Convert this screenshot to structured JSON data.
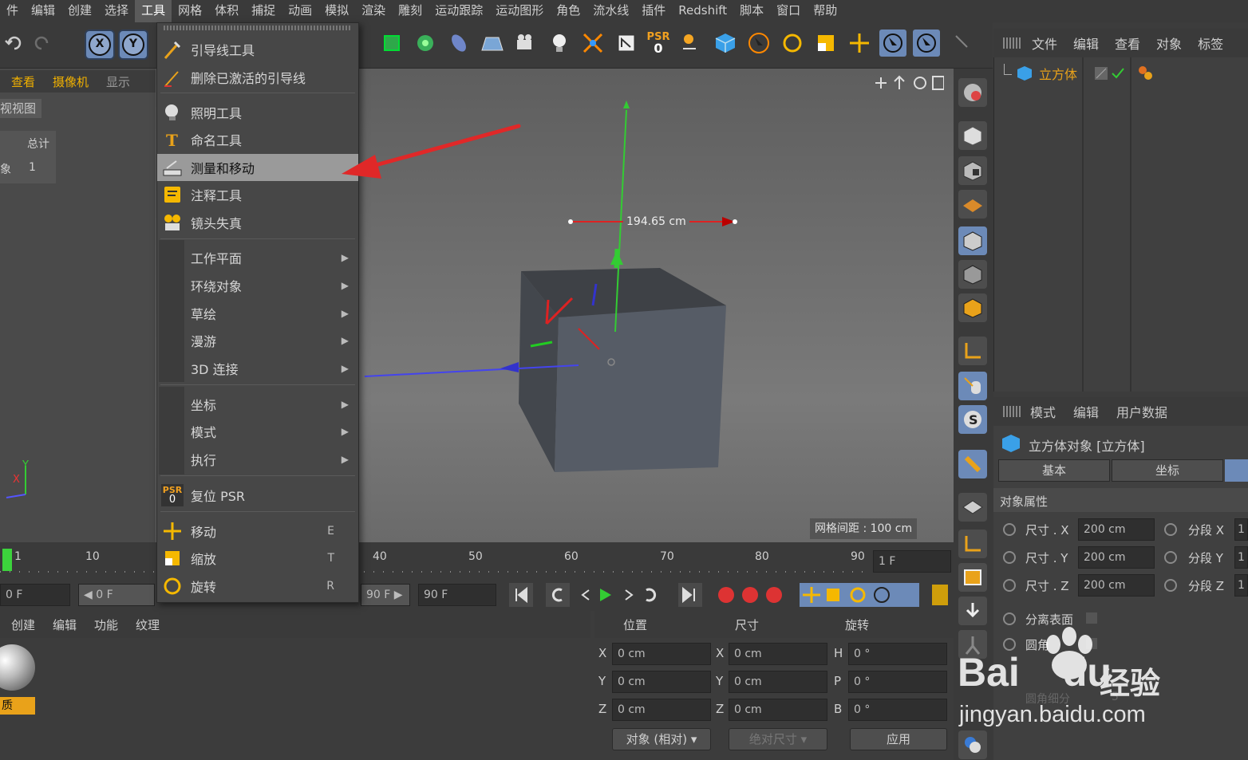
{
  "menubar": [
    "件",
    "编辑",
    "创建",
    "选择",
    "工具",
    "网格",
    "体积",
    "捕捉",
    "动画",
    "模拟",
    "渲染",
    "雕刻",
    "运动跟踪",
    "运动图形",
    "角色",
    "流水线",
    "插件",
    "Redshift",
    "脚本",
    "窗口",
    "帮助"
  ],
  "toolbar": {
    "psr_label": "PSR",
    "psr_value": "0"
  },
  "viewport": {
    "tabs": [
      "查看",
      "摄像机",
      "显示"
    ],
    "view_name": "视视图",
    "stats_header": "总计",
    "stats_label": "象",
    "stats_value": "1",
    "measure_label": "194.65 cm",
    "grid_spacing": "网格间距 : 100 cm",
    "axis_y": "Y",
    "axis_x": "X"
  },
  "tools_menu": {
    "items": [
      {
        "label": "引导线工具",
        "shortcut": "",
        "submenu": false
      },
      {
        "label": "删除已激活的引导线",
        "shortcut": "",
        "submenu": false
      },
      {
        "label": "照明工具",
        "shortcut": "",
        "submenu": false
      },
      {
        "label": "命名工具",
        "shortcut": "",
        "submenu": false
      },
      {
        "label": "测量和移动",
        "shortcut": "",
        "submenu": false
      },
      {
        "label": "注释工具",
        "shortcut": "",
        "submenu": false
      },
      {
        "label": "镜头失真",
        "shortcut": "",
        "submenu": false
      },
      {
        "label": "工作平面",
        "shortcut": "",
        "submenu": true
      },
      {
        "label": "环绕对象",
        "shortcut": "",
        "submenu": true
      },
      {
        "label": "草绘",
        "shortcut": "",
        "submenu": true
      },
      {
        "label": "漫游",
        "shortcut": "",
        "submenu": true
      },
      {
        "label": "3D 连接",
        "shortcut": "",
        "submenu": true
      },
      {
        "label": "坐标",
        "shortcut": "",
        "submenu": true
      },
      {
        "label": "模式",
        "shortcut": "",
        "submenu": true
      },
      {
        "label": "执行",
        "shortcut": "",
        "submenu": true
      },
      {
        "label": "复位 PSR",
        "shortcut": "",
        "submenu": false
      },
      {
        "label": "移动",
        "shortcut": "E",
        "submenu": false
      },
      {
        "label": "缩放",
        "shortcut": "T",
        "submenu": false
      },
      {
        "label": "旋转",
        "shortcut": "R",
        "submenu": false
      }
    ],
    "psr_icon_text": "PSR",
    "psr_icon_num": "0"
  },
  "timeline": {
    "ticks": [
      "1",
      "10",
      "40",
      "50",
      "60",
      "70",
      "80",
      "90"
    ],
    "current_frame": "1 F"
  },
  "playback": {
    "start_field": "0 F",
    "start_field2": "◀ 0 F",
    "end_field2": "90 F ▶",
    "end_field": "90 F"
  },
  "material_panel": {
    "tabs": [
      "创建",
      "编辑",
      "功能",
      "纹理"
    ],
    "material_label": "质"
  },
  "coords_panel": {
    "headers": [
      "位置",
      "尺寸",
      "旋转"
    ],
    "rows": [
      {
        "axis": "X",
        "pos": "0 cm",
        "size_axis": "X",
        "size": "0 cm",
        "rot_axis": "H",
        "rot": "0 °"
      },
      {
        "axis": "Y",
        "pos": "0 cm",
        "size_axis": "Y",
        "size": "0 cm",
        "rot_axis": "P",
        "rot": "0 °"
      },
      {
        "axis": "Z",
        "pos": "0 cm",
        "size_axis": "Z",
        "size": "0 cm",
        "rot_axis": "B",
        "rot": "0 °"
      }
    ],
    "mode_select": "对象 (相对)",
    "size_select": "绝对尺寸",
    "apply": "应用"
  },
  "object_manager": {
    "tabs": [
      "文件",
      "编辑",
      "查看",
      "对象",
      "标签"
    ],
    "object_name": "立方体"
  },
  "attributes": {
    "tabs": [
      "模式",
      "编辑",
      "用户数据"
    ],
    "title": "立方体对象 [立方体]",
    "subtabs": [
      "基本",
      "坐标"
    ],
    "section": "对象属性",
    "rows": [
      {
        "label": "尺寸 . X",
        "value": "200 cm",
        "seg_label": "分段 X",
        "seg": "1"
      },
      {
        "label": "尺寸 . Y",
        "value": "200 cm",
        "seg_label": "分段 Y",
        "seg": "1"
      },
      {
        "label": "尺寸 . Z",
        "value": "200 cm",
        "seg_label": "分段 Z",
        "seg": "1"
      }
    ],
    "separate_surfaces": "分离表面",
    "fillet": "圆角",
    "fillet_sub": "圆角细分",
    "fillet_sub_val": "5"
  },
  "watermark": {
    "brand": "Bai",
    "brand2": "du",
    "cn": "经验",
    "url": "jingyan.baidu.com"
  },
  "colors": {
    "highlight": "#9a9a9a",
    "accent_blue": "#6c8ab8",
    "arrow_red": "#e02828",
    "obj_orange": "#e9a21a"
  }
}
